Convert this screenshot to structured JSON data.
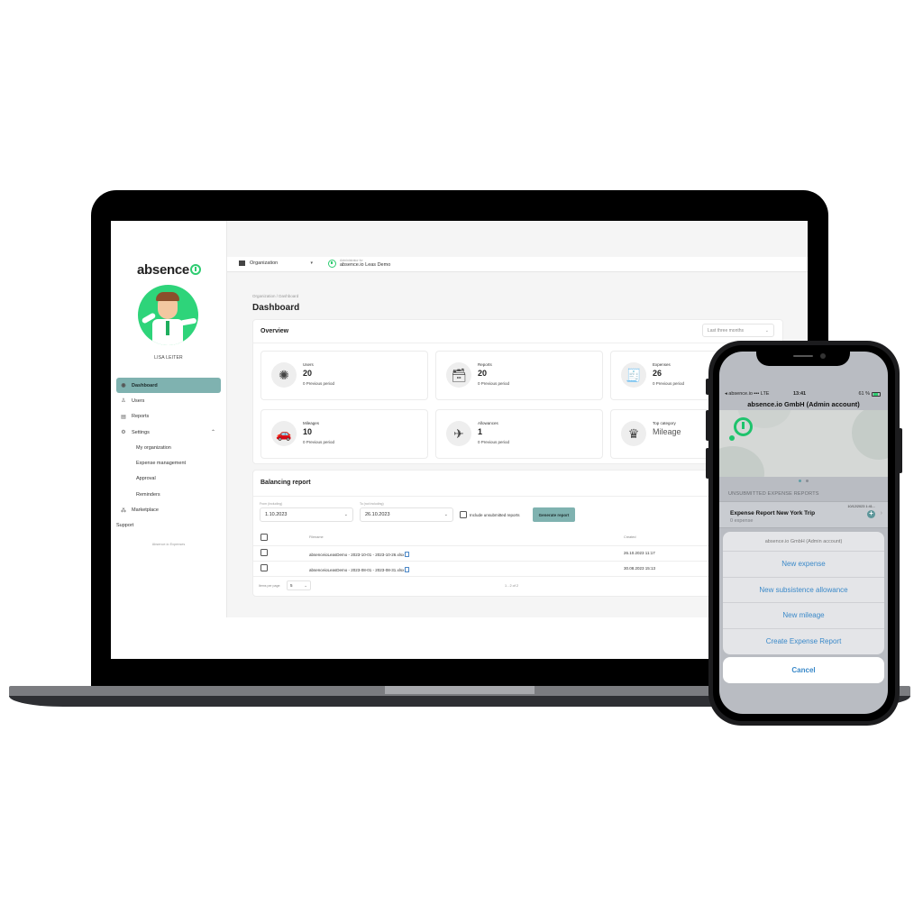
{
  "laptop": {
    "brand": "absence",
    "user_name": "LISA LEITER",
    "sidebar": {
      "items": [
        {
          "label": "Dashboard",
          "icon": "eye-icon",
          "active": true
        },
        {
          "label": "Users",
          "icon": "users-icon"
        },
        {
          "label": "Reports",
          "icon": "clipboard-icon"
        },
        {
          "label": "Settings",
          "icon": "gear-icon",
          "expanded": true
        },
        {
          "label": "My organization"
        },
        {
          "label": "Expense management"
        },
        {
          "label": "Approval"
        },
        {
          "label": "Reminders"
        },
        {
          "label": "Marketplace",
          "icon": "marketplace-icon"
        },
        {
          "label": "Support"
        }
      ],
      "footer": "Absence.io Expenses"
    },
    "topbar": {
      "org_label": "Organization",
      "admin_caption": "Administrator for",
      "admin_org": "absence.io Leas Demo"
    },
    "breadcrumb": "Organization / Dashboard",
    "page_title": "Dashboard",
    "overview": {
      "title": "Overview",
      "period": "Last three months",
      "stats": [
        {
          "label": "Users",
          "value": "20",
          "sub": "0 Previous period",
          "icon": "network-icon"
        },
        {
          "label": "Reports",
          "value": "20",
          "sub": "0 Previous period",
          "icon": "drawer-icon"
        },
        {
          "label": "Expenses",
          "value": "26",
          "sub": "0 Previous period",
          "icon": "receipts-icon"
        },
        {
          "label": "Mileages",
          "value": "10",
          "sub": "0 Previous period",
          "icon": "car-icon"
        },
        {
          "label": "Allowances",
          "value": "1",
          "sub": "0 Previous period",
          "icon": "airplane-icon"
        },
        {
          "label": "Top category",
          "value": "Mileage",
          "sub": "",
          "icon": "crown-icon"
        }
      ]
    },
    "balancing": {
      "title": "Balancing report",
      "from_label": "From (including)",
      "from_value": "1.10.2023",
      "to_label": "To (not including)",
      "to_value": "26.10.2023",
      "include_label": "Include unsubmitted reports",
      "generate_label": "Generate report",
      "columns": {
        "filename": "Filename",
        "created": "Created"
      },
      "rows": [
        {
          "filename": "absenceioLeasDemo - 2023-10-01 - 2023-10-26.xlsx",
          "created": "26.10.2023 11:17"
        },
        {
          "filename": "absenceioLeasDemo - 2023-08-01 - 2023-08-31.xlsx",
          "created": "30.08.2023 15:13"
        }
      ],
      "items_per_page_label": "Items per page:",
      "items_per_page": "5",
      "range": "1 - 2 of 2"
    }
  },
  "phone": {
    "status": {
      "carrier": "◂ absence.io ▪▪▪ LTE",
      "time": "13:41",
      "battery": "61 %"
    },
    "title": "absence.io GmbH (Admin account)",
    "section_header": "UNSUBMITTED EXPENSE REPORTS",
    "report": {
      "title": "Expense Report New York Trip",
      "sub": "0 expense",
      "date": "10/12/2023 1:41..."
    },
    "sheet": {
      "title": "absence.io GmbH (Admin account)",
      "actions": [
        "New expense",
        "New subsistence allowance",
        "New mileage",
        "Create Expense Report"
      ],
      "cancel": "Cancel"
    }
  }
}
